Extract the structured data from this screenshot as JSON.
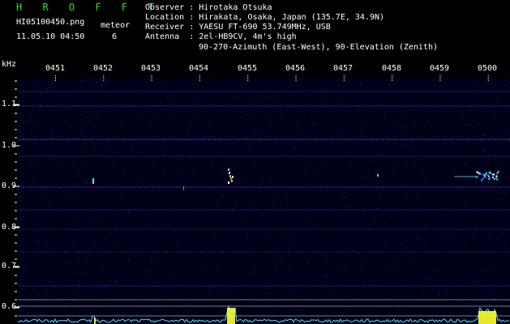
{
  "header": {
    "app_title": "H R O F F T",
    "file_name": "HI05100450.png",
    "datetime": "11.05.10 04:50",
    "meteor_label": "meteor",
    "meteor_count": "6",
    "info": [
      {
        "label": "Observer",
        "value": "Hirotaka Otsuka"
      },
      {
        "label": "Location",
        "value": "Hirakata, Osaka, Japan (135.7E, 34.9N)"
      },
      {
        "label": "Receiver",
        "value": "YAESU FT-690 53.749MHz, USB"
      },
      {
        "label": "Antenna ",
        "value": "2el-HB9CV, 4m's high"
      }
    ],
    "antenna_line2": "90-270-Azimuth (East-West), 90-Elevation (Zenith)"
  },
  "axes": {
    "y_unit": "kHz",
    "y_ticks": [
      "1.1",
      "1.0",
      "0.9",
      "0.8",
      "0.7",
      "0.6"
    ],
    "x_ticks": [
      "0451",
      "0452",
      "0453",
      "0454",
      "0455",
      "0456",
      "0457",
      "0458",
      "0459",
      "0500"
    ]
  },
  "colors": {
    "background": "#000000",
    "plot_bg": "#000018",
    "noise": "#2a2aa0",
    "band_line": "#4646e0",
    "grid": "#9a9aa6",
    "signal_cyan": "#3fe6ff",
    "signal_yellow": "#ffff30",
    "header_green": "#2fdc3c"
  }
}
